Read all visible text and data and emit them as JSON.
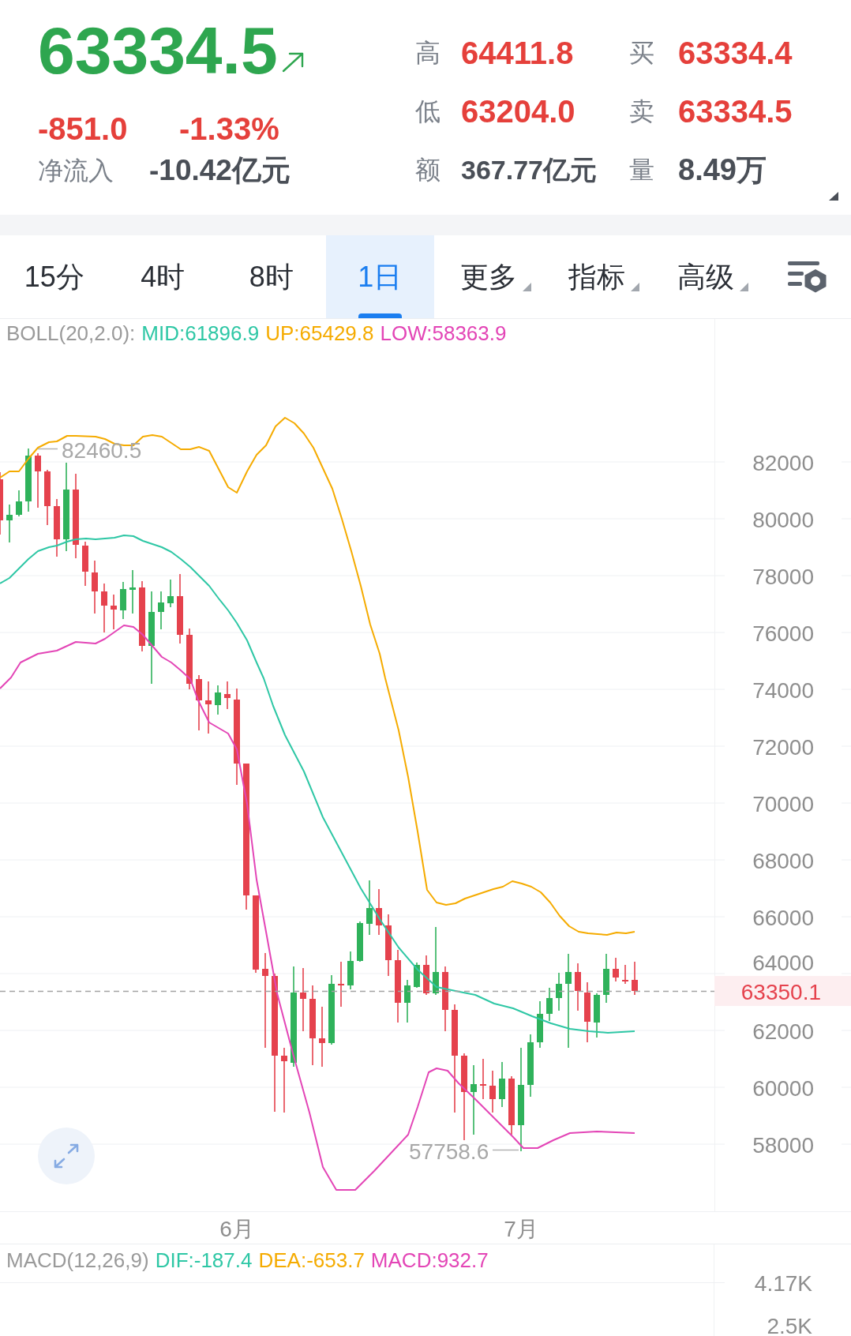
{
  "quote": {
    "rising": true,
    "price": "63334.5",
    "change": "-851.0",
    "change_percent": "-1.33%",
    "net_inflow_label": "净流入",
    "net_inflow": "-10.42亿元",
    "stats": [
      {
        "label": "高",
        "value": "64411.8",
        "kind": "price"
      },
      {
        "label": "买",
        "value": "63334.4",
        "kind": "price"
      },
      {
        "label": "低",
        "value": "63204.0",
        "kind": "price"
      },
      {
        "label": "卖",
        "value": "63334.5",
        "kind": "price"
      },
      {
        "label": "额",
        "value": "367.77亿元",
        "kind": "volume"
      },
      {
        "label": "量",
        "value": "8.49万",
        "kind": "volume"
      }
    ]
  },
  "tabs": [
    {
      "label": "15分",
      "selected": false,
      "kind": "period"
    },
    {
      "label": "4时",
      "selected": false,
      "kind": "period"
    },
    {
      "label": "8时",
      "selected": false,
      "kind": "period"
    },
    {
      "label": "1日",
      "selected": true,
      "kind": "period"
    },
    {
      "label": "更多",
      "selected": false,
      "kind": "menu"
    },
    {
      "label": "指标",
      "selected": false,
      "kind": "menu"
    },
    {
      "label": "高级",
      "selected": false,
      "kind": "menu"
    }
  ],
  "main_chart": {
    "indicator": "BOLL(20,2.0):",
    "legend": [
      {
        "text": "MID:61896.9",
        "color": "#2ec7a5"
      },
      {
        "text": "UP:65429.8",
        "color": "#f5ab00"
      },
      {
        "text": "LOW:58363.9",
        "color": "#e345b6"
      }
    ],
    "y_axis": [
      "82000",
      "80000",
      "78000",
      "76000",
      "74000",
      "72000",
      "70000",
      "68000",
      "66000",
      "64000",
      "62000",
      "60000",
      "58000"
    ],
    "x_axis": [
      "6月",
      "7月"
    ],
    "high_marker": "82460.5",
    "low_marker": "57758.6",
    "last_price": "63350.1"
  },
  "macd_chart": {
    "indicator": "MACD(12,26,9)",
    "legend": [
      {
        "text": "DIF:-187.4",
        "color": "#2ec7a5"
      },
      {
        "text": "DEA:-653.7",
        "color": "#f5ab00"
      },
      {
        "text": "MACD:932.7",
        "color": "#e345b6"
      }
    ],
    "y_axis": [
      "4.17K",
      "2.5K"
    ]
  }
}
